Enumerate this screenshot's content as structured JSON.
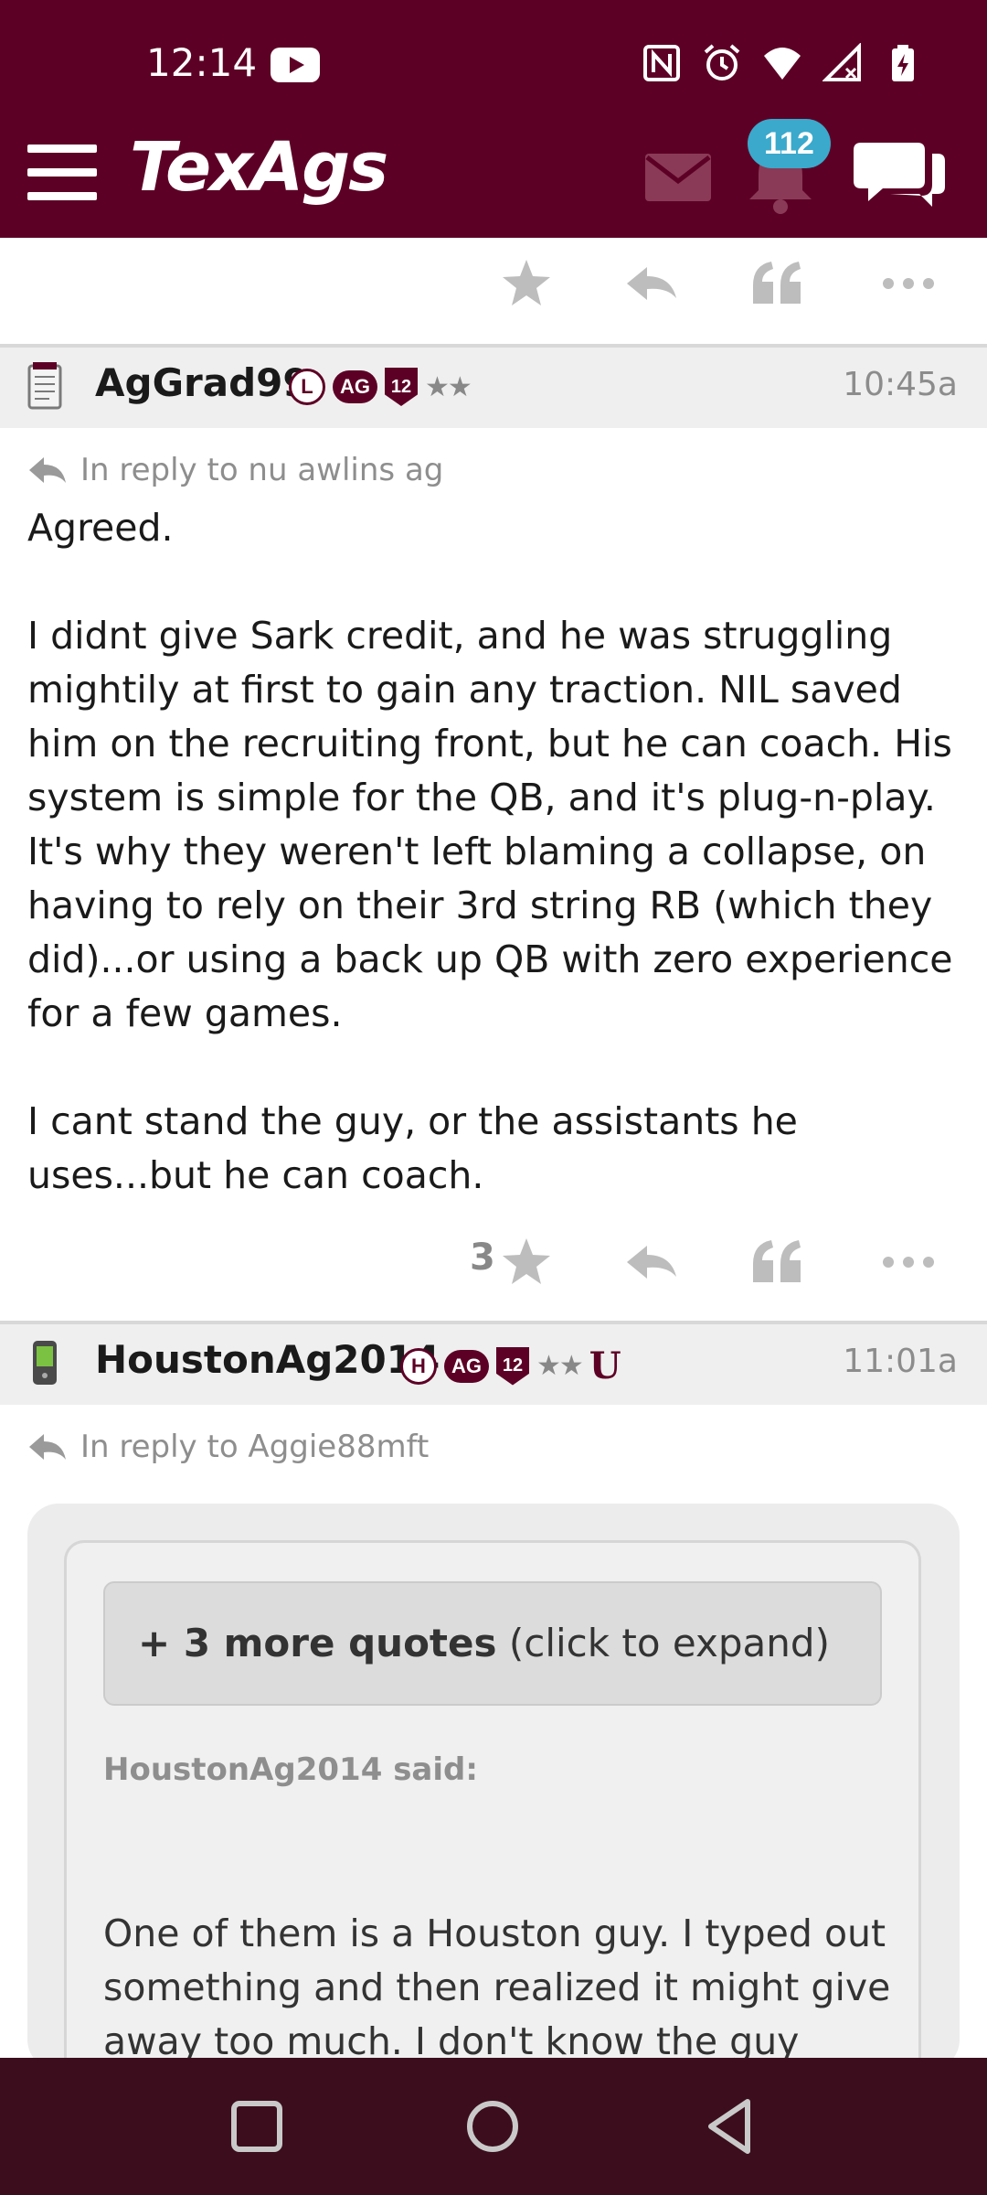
{
  "status_bar": {
    "time": "12:14",
    "icons": [
      "youtube-icon",
      "nfc-icon",
      "alarm-icon",
      "wifi-icon",
      "signal-icon",
      "battery-charging-icon"
    ]
  },
  "header": {
    "logo": "TexAgs",
    "notification_count": "112",
    "brand_color": "#5d0025",
    "badge_color": "#3aa9cc"
  },
  "posts": [
    {
      "username": "AgGrad99",
      "badges": [
        "L",
        "AG",
        "12",
        "★★"
      ],
      "time": "10:45a",
      "reply_to": "In reply to nu awlins ag",
      "paragraphs": [
        "Agreed.",
        "I didnt give Sark credit, and he was struggling mightily at first to gain any traction. NIL saved him on the recruiting front, but he can coach. His system is simple for the QB, and it's plug-n-play. It's why they weren't left blaming a collapse, on having to rely on their 3rd string RB (which they did)...or using a back up QB with zero experience for a few games.",
        "I cant stand the guy, or the assistants he uses...but he can coach."
      ],
      "star_count": "3"
    },
    {
      "username": "HoustonAg2014",
      "badges": [
        "H",
        "AG",
        "12",
        "★★",
        "U"
      ],
      "time": "11:01a",
      "reply_to": "In reply to Aggie88mft",
      "quote": {
        "expand_bold": "+ 3 more quotes",
        "expand_rest": " (click to expand)",
        "said": "HoustonAg2014 said:",
        "text": "One of them is a Houston guy. I typed out something and then realized it might give away too much. I don't know the guy"
      }
    }
  ]
}
